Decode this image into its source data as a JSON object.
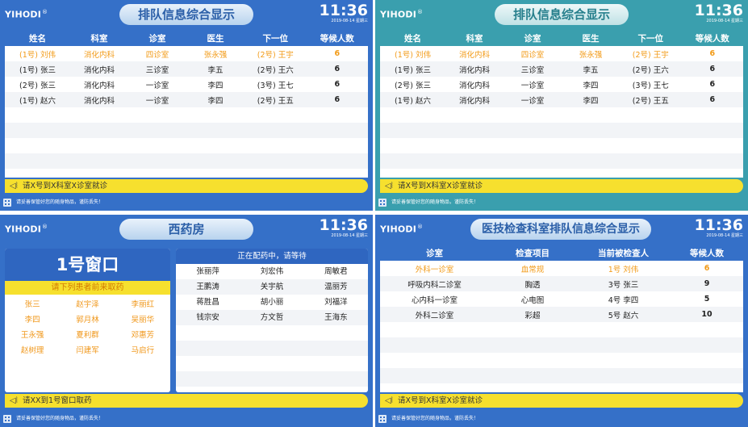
{
  "brand": "YIHODI",
  "brand_mark": "®",
  "clock": {
    "time": "11:36",
    "date": "2019-08-14 星期三"
  },
  "notice_queue": "请X号到X科室X诊室就诊",
  "notice_pharmacy": "请XX到1号窗口取药",
  "footer": "请妥善保管好您的随身物品，谨防丢失！",
  "colors": {
    "blue": "#3570c8",
    "teal": "#3a9fae",
    "yellow": "#f6e02e",
    "orange": "#f29a16"
  },
  "icons": {
    "notice": "speaker-icon",
    "footer": "app-grid-icon"
  },
  "queue": {
    "title": "排队信息综合显示",
    "headers": [
      "姓名",
      "科室",
      "诊室",
      "医生",
      "下一位",
      "等候人数"
    ],
    "rows": [
      [
        "(1号) 刘伟",
        "消化内科",
        "四诊室",
        "张永强",
        "(2号) 王宇",
        "6"
      ],
      [
        "(1号) 张三",
        "消化内科",
        "三诊室",
        "李五",
        "(2号) 王六",
        "6"
      ],
      [
        "(2号) 张三",
        "消化内科",
        "一诊室",
        "李四",
        "(3号) 王七",
        "6"
      ],
      [
        "(1号) 赵六",
        "消化内科",
        "一诊室",
        "李四",
        "(2号) 王五",
        "6"
      ]
    ]
  },
  "pharmacy": {
    "title": "西药房",
    "window": "1号窗口",
    "pickup_prompt": "请下列患者前来取药",
    "pickup_names": [
      "张三",
      "赵宇泽",
      "李丽红",
      "李四",
      "郭月林",
      "吴丽华",
      "王永强",
      "夏利群",
      "邓惠芳",
      "赵树理",
      "闫建军",
      "马启行"
    ],
    "waiting_header": "正在配药中，请等待",
    "waiting_names": [
      "张丽萍",
      "刘宏伟",
      "周敏君",
      "王鹏涛",
      "关宇航",
      "温丽芳",
      "蒋胜昌",
      "胡小丽",
      "刘福洋",
      "钱宗安",
      "方文哲",
      "王海东"
    ]
  },
  "exam": {
    "title": "医技检查科室排队信息综合显示",
    "headers": [
      "诊室",
      "检查项目",
      "当前被检查人",
      "等候人数"
    ],
    "rows": [
      [
        "外科一诊室",
        "血常规",
        "1号 刘伟",
        "6"
      ],
      [
        "呼吸内科二诊室",
        "胸透",
        "3号 张三",
        "9"
      ],
      [
        "心内科一诊室",
        "心电图",
        "4号 李四",
        "5"
      ],
      [
        "外科二诊室",
        "彩超",
        "5号 赵六",
        "10"
      ]
    ]
  }
}
